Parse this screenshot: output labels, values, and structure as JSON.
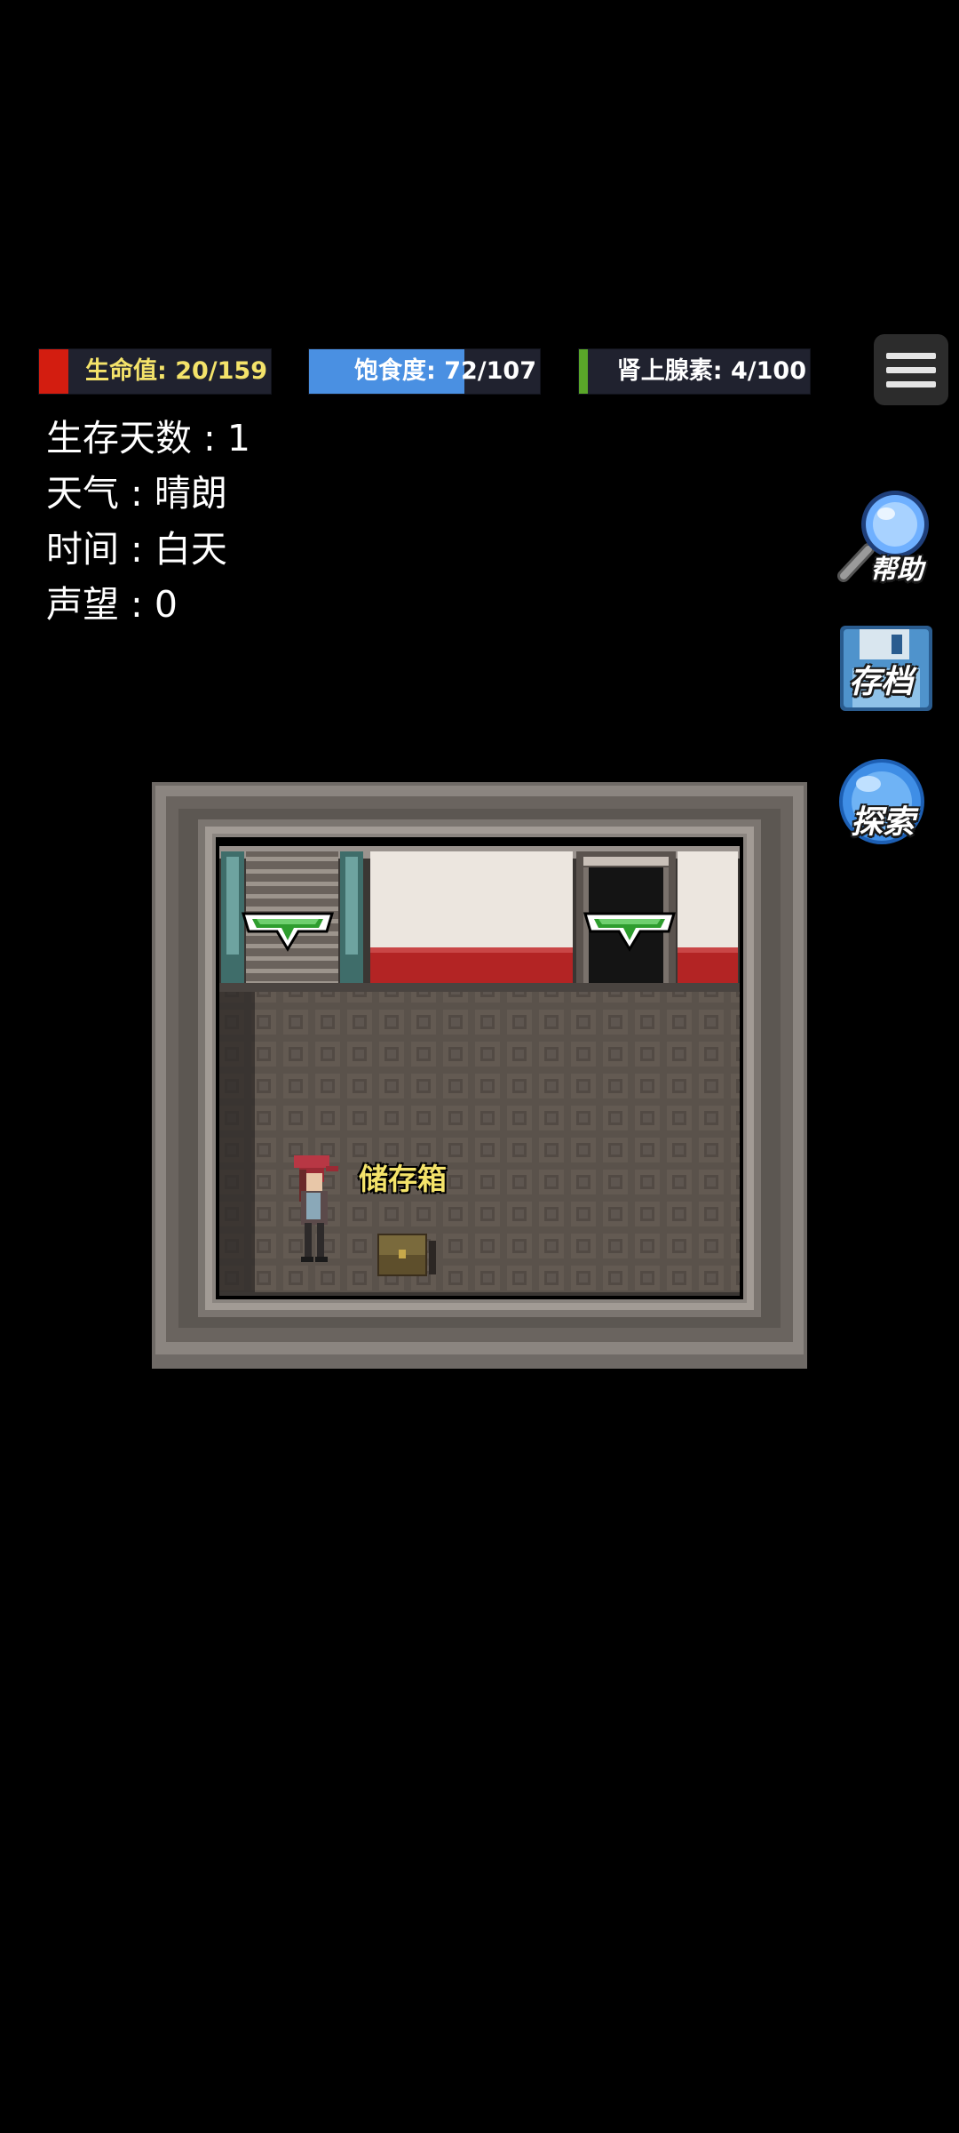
{
  "stats": {
    "hp": {
      "label": "生命值: 20/159",
      "current": 20,
      "max": 159,
      "fill_color": "#d31d10",
      "text_color": "#f4e36a"
    },
    "hunger": {
      "label": "饱食度: 72/107",
      "current": 72,
      "max": 107,
      "fill_color": "#4a90e2",
      "text_color": "#ffffff"
    },
    "adrenaline": {
      "label": "肾上腺素: 4/100",
      "current": 4,
      "max": 100,
      "fill_color": "#5aa629",
      "text_color": "#ffffff"
    }
  },
  "info": {
    "days": "生存天数 : 1",
    "weather": "天气 : 晴朗",
    "time": "时间 : 白天",
    "reputation": "声望 : 0"
  },
  "buttons": {
    "menu_icon": "hamburger-menu-icon",
    "help": {
      "label": "帮助",
      "icon": "magnifier-icon"
    },
    "save": {
      "label": "存档",
      "icon": "floppy-disk-icon"
    },
    "explore": {
      "label": "探索",
      "icon": "globe-icon"
    }
  },
  "scene": {
    "chest_label": "储存箱",
    "exits": [
      "stairs-exit-arrow-icon",
      "door-exit-arrow-icon"
    ]
  }
}
